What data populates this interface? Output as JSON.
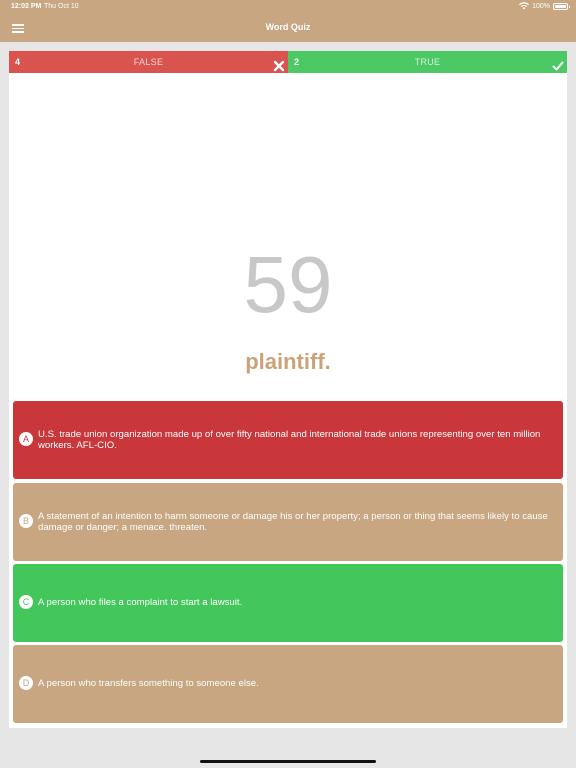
{
  "status": {
    "time": "12:02 PM",
    "date": "Thu Oct 10",
    "battery": "100%",
    "icons": [
      "wifi-icon",
      "battery-icon"
    ]
  },
  "nav": {
    "title": "Word Quiz",
    "menu_icon": "hamburger-menu-icon"
  },
  "score": {
    "false_count": "4",
    "false_label": "FALSE",
    "true_count": "2",
    "true_label": "TRUE",
    "false_icon": "x-icon",
    "true_icon": "checkmark-icon"
  },
  "quiz": {
    "counter": "59",
    "word": "plaintiff."
  },
  "answers": [
    {
      "letter": "A",
      "text": "U.S. trade union organization made up of over fifty national and international trade unions representing over ten million workers. AFL-CIO.",
      "state": "wrong"
    },
    {
      "letter": "B",
      "text": "A statement of an intention to harm someone or damage his or her property; a person or thing that seems likely to cause damage or danger; a menace. threaten.",
      "state": "neutral"
    },
    {
      "letter": "C",
      "text": "A person who files a complaint to start a lawsuit.",
      "state": "correct"
    },
    {
      "letter": "D",
      "text": "A person who transfers something to someone else.",
      "state": "neutral"
    }
  ],
  "colors": {
    "brand": "#c7a681",
    "false": "#d9534f",
    "true": "#4cc864",
    "wrong_answer": "#c9373a",
    "correct_answer": "#43c75a"
  }
}
